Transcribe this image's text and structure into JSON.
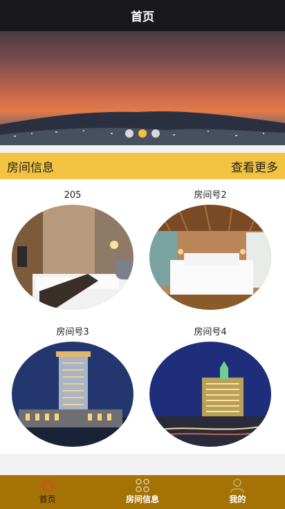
{
  "navbar": {
    "title": "首页"
  },
  "banner": {
    "slide_count": 3,
    "active_index": 1
  },
  "section": {
    "title": "房间信息",
    "more_link": "查看更多"
  },
  "rooms": [
    {
      "name": "205",
      "photo": "hotel-bedroom"
    },
    {
      "name": "房间号2",
      "photo": "wooden-bedroom"
    },
    {
      "name": "房间号3",
      "photo": "hotel-tower-night"
    },
    {
      "name": "房间号4",
      "photo": "hotel-palace-night"
    }
  ],
  "tabbar": {
    "items": [
      {
        "label": "首页",
        "icon": "home-icon",
        "active": true
      },
      {
        "label": "房间信息",
        "icon": "grid-icon",
        "active": false
      },
      {
        "label": "我的",
        "icon": "user-icon",
        "active": false
      }
    ]
  },
  "colors": {
    "accent": "#f2c241",
    "tabbar": "#a57305",
    "navbar": "#19181d",
    "active_tab": "#e0462a"
  }
}
